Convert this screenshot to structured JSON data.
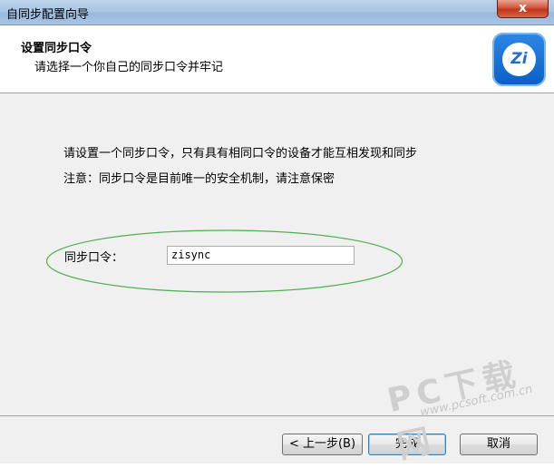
{
  "window": {
    "title": "自同步配置向导",
    "close_glyph": "x"
  },
  "header": {
    "title": "设置同步口令",
    "subtitle": "请选择一个你自己的同步口令并牢记",
    "logo_text": "Zi"
  },
  "body": {
    "line1": "请设置一个同步口令，只有具有相同口令的设备才能互相发现和同步",
    "line2": "注意：同步口令是目前唯一的安全机制，请注意保密",
    "password_label": "同步口令：",
    "password_value": "zisync"
  },
  "buttons": {
    "back": "< 上一步(B)",
    "finish": "完成",
    "cancel": "取消"
  },
  "watermark": {
    "main": "PC下载网",
    "url": "www.pcsoft.com.cn"
  },
  "colors": {
    "highlight_ellipse": "#4caf50",
    "titlebar": "#a9c6e4",
    "close_button": "#c1351b",
    "logo": "#1a6fd6"
  }
}
